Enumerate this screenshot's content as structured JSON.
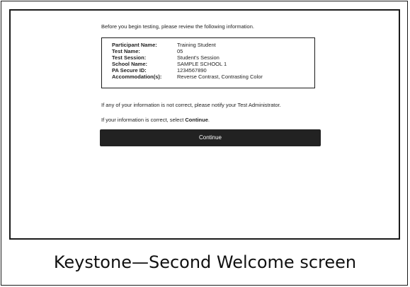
{
  "screen": {
    "intro_text": "Before you begin testing, please review the following information.",
    "info": [
      {
        "label": "Participant Name:",
        "value": "Training Student"
      },
      {
        "label": "Test Name:",
        "value": "05"
      },
      {
        "label": "Test Session:",
        "value": "Student's Session"
      },
      {
        "label": "School Name:",
        "value": "SAMPLE SCHOOL 1"
      },
      {
        "label": "PA Secure ID:",
        "value": "1234567890"
      },
      {
        "label": "Accommodation(s):",
        "value": "Reverse Contrast, Contrasting Color"
      }
    ],
    "notice_text": "If any of your information is not correct, please notify your Test Administrator.",
    "correct_prefix": "If your information is correct, select ",
    "correct_bold": "Continue",
    "correct_suffix": ".",
    "continue_label": "Continue"
  },
  "caption": "Keystone—Second Welcome screen",
  "colors": {
    "button_bg": "#222222",
    "button_text": "#ffffff",
    "border": "#1a1a1a"
  }
}
